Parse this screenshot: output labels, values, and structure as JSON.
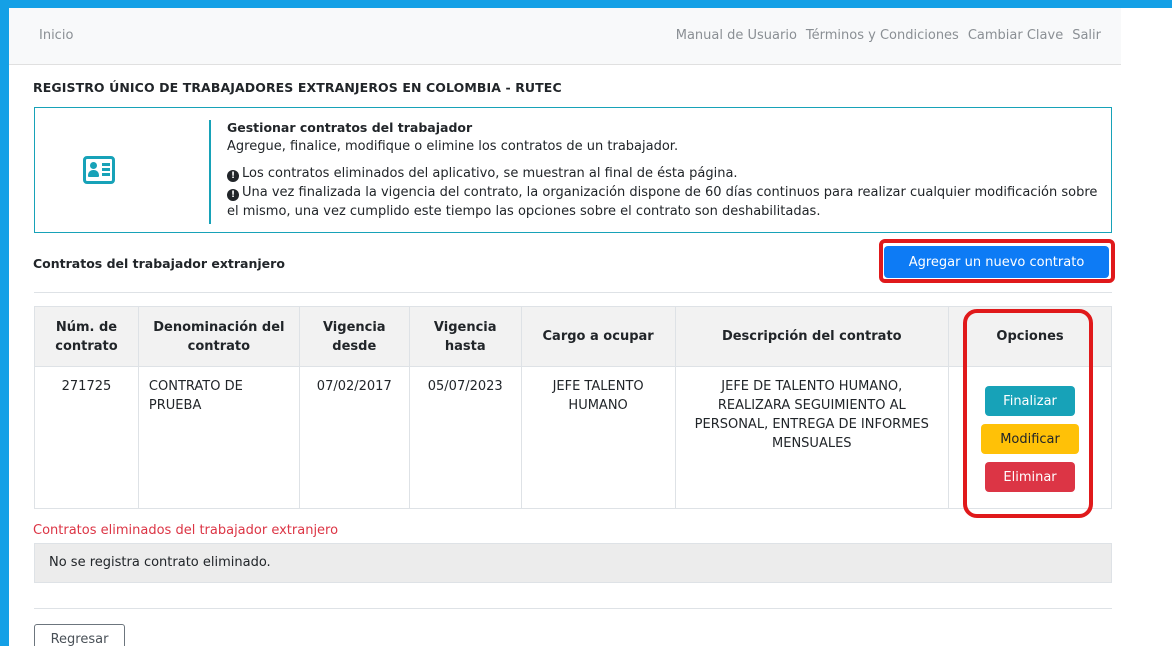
{
  "nav": {
    "home": "Inicio",
    "links": [
      "Manual de Usuario",
      "Términos y Condiciones",
      "Cambiar Clave",
      "Salir"
    ]
  },
  "page_title": "REGISTRO ÚNICO DE TRABAJADORES EXTRANJEROS EN COLOMBIA - RUTEC",
  "info": {
    "icon": "id-card-icon",
    "heading": "Gestionar contratos del trabajador",
    "subheading": "Agregue, finalice, modifique o elimine los contratos de un trabajador.",
    "note1": "Los contratos eliminados del aplicativo, se muestran al final de ésta página.",
    "note2": "Una vez finalizada la vigencia del contrato, la organización dispone de 60 días continuos para realizar cualquier modificación sobre el mismo, una vez cumplido este tiempo las opciones sobre el contrato son deshabilitadas."
  },
  "contracts": {
    "title": "Contratos del trabajador extranjero",
    "add_button": "Agregar un nuevo contrato",
    "headers": {
      "num": "Núm. de contrato",
      "name": "Denominación del contrato",
      "from": "Vigencia desde",
      "to": "Vigencia hasta",
      "position": "Cargo a ocupar",
      "description": "Descripción del contrato",
      "options": "Opciones"
    },
    "rows": [
      {
        "num": "271725",
        "name": "CONTRATO DE PRUEBA",
        "from": "07/02/2017",
        "to": "05/07/2023",
        "position": "JEFE TALENTO HUMANO",
        "description": "JEFE DE TALENTO HUMANO, REALIZARA SEGUIMIENTO AL PERSONAL, ENTREGA DE INFORMES MENSUALES",
        "actions": {
          "finish": "Finalizar",
          "modify": "Modificar",
          "delete": "Eliminar"
        }
      }
    ]
  },
  "deleted": {
    "title": "Contratos eliminados del trabajador extranjero",
    "empty_message": "No se registra contrato eliminado."
  },
  "back_button": "Regresar",
  "colors": {
    "frame": "#14a0e6",
    "info": "#17a2b8",
    "primary": "#0d7bf5",
    "warning": "#ffc107",
    "danger": "#dc3545",
    "highlight": "#e0191b"
  }
}
